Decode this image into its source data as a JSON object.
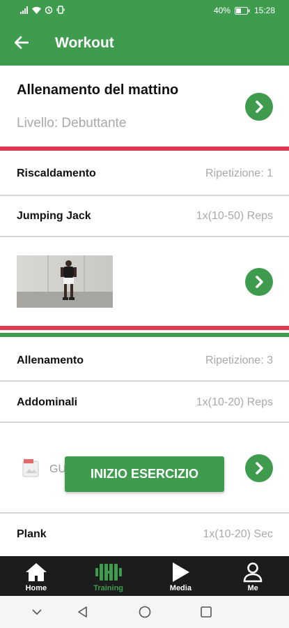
{
  "status_bar": {
    "battery": "40%",
    "time": "15:28"
  },
  "app_bar": {
    "title": "Workout"
  },
  "workout": {
    "name": "Allenamento del mattino",
    "level": "Livello: Debuttante"
  },
  "warmup": {
    "title": "Riscaldamento",
    "repetition": "Ripetizione: 1",
    "exercise": {
      "name": "Jumping Jack",
      "reps": "1x(10-50) Reps"
    }
  },
  "training": {
    "title": "Allenamento",
    "repetition": "Ripetizione: 3",
    "exercises": [
      {
        "name": "Addominali",
        "reps": "1x(10-20) Reps",
        "thumb_text": "GU"
      },
      {
        "name": "Plank",
        "reps": "1x(10-20) Sec"
      }
    ]
  },
  "start_button": {
    "label": "INIZIO ESERCIZIO"
  },
  "bottom_nav": [
    {
      "label": "Home",
      "icon": "home-icon"
    },
    {
      "label": "Training",
      "icon": "dumbbell-icon"
    },
    {
      "label": "Media",
      "icon": "play-icon"
    },
    {
      "label": "Me",
      "icon": "user-icon"
    }
  ],
  "colors": {
    "primary": "#3f9c4f",
    "accent_red": "#e0394f",
    "nav_bg": "#1c1c1c"
  }
}
